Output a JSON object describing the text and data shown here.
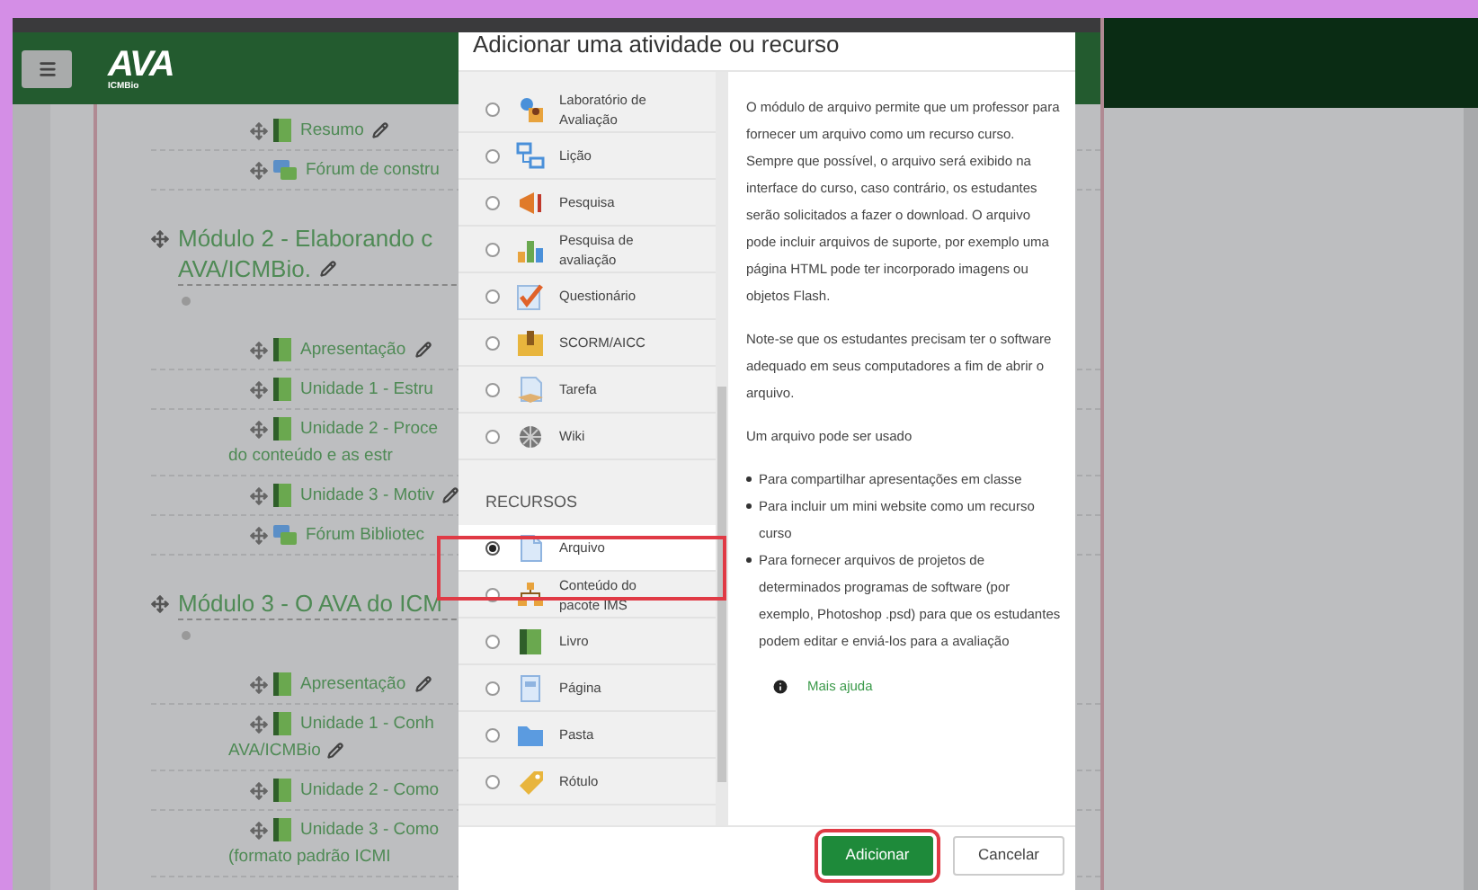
{
  "header": {
    "logo": "AVA",
    "logo_subtitle": "ICMBio"
  },
  "course": {
    "sections": [
      {
        "activities": [
          {
            "kind": "book",
            "lines": [
              "Resumo"
            ],
            "editable": true
          },
          {
            "kind": "forum",
            "lines": [
              "Fórum de constru"
            ],
            "editable": false
          }
        ]
      },
      {
        "title_lines": [
          "Módulo 2 - Elaborando c",
          "AVA/ICMBio."
        ],
        "activities": [
          {
            "kind": "book",
            "lines": [
              "Apresentação"
            ],
            "editable": true
          },
          {
            "kind": "book",
            "lines": [
              "Unidade 1 - Estru"
            ],
            "editable": false
          },
          {
            "kind": "book",
            "lines": [
              "Unidade 2 - Proce",
              "do conteúdo e as estr"
            ],
            "editable": false
          },
          {
            "kind": "book",
            "lines": [
              "Unidade 3 - Motiv"
            ],
            "editable": true
          },
          {
            "kind": "forum",
            "lines": [
              "Fórum Bibliotec"
            ],
            "editable": false
          }
        ]
      },
      {
        "title_lines": [
          "Módulo 3 - O AVA do ICM"
        ],
        "activities": [
          {
            "kind": "book",
            "lines": [
              "Apresentação"
            ],
            "editable": true
          },
          {
            "kind": "book",
            "lines": [
              "Unidade 1 - Conh",
              "AVA/ICMBio"
            ],
            "editable": true
          },
          {
            "kind": "book",
            "lines": [
              "Unidade 2 - Como"
            ],
            "editable": false
          },
          {
            "kind": "book",
            "lines": [
              "Unidade 3 - Como",
              "(formato padrão ICMI"
            ],
            "editable": false
          }
        ]
      }
    ]
  },
  "dialog": {
    "title": "Adicionar uma atividade ou recurso",
    "activities": [
      {
        "label": "Laboratório de Avaliação",
        "kind": "workshop",
        "selected": false
      },
      {
        "label": "Lição",
        "kind": "lesson",
        "selected": false
      },
      {
        "label": "Pesquisa",
        "kind": "survey",
        "selected": false
      },
      {
        "label": "Pesquisa de avaliação",
        "kind": "feedback",
        "selected": false
      },
      {
        "label": "Questionário",
        "kind": "quiz",
        "selected": false
      },
      {
        "label": "SCORM/AICC",
        "kind": "scorm",
        "selected": false
      },
      {
        "label": "Tarefa",
        "kind": "assignment",
        "selected": false
      },
      {
        "label": "Wiki",
        "kind": "wiki",
        "selected": false
      }
    ],
    "resources_heading": "RECURSOS",
    "resources": [
      {
        "label": "Arquivo",
        "kind": "file",
        "selected": true
      },
      {
        "label": "Conteúdo do pacote IMS",
        "kind": "ims",
        "selected": false
      },
      {
        "label": "Livro",
        "kind": "book",
        "selected": false
      },
      {
        "label": "Página",
        "kind": "page",
        "selected": false
      },
      {
        "label": "Pasta",
        "kind": "folder",
        "selected": false
      },
      {
        "label": "Rótulo",
        "kind": "label",
        "selected": false
      }
    ],
    "description": {
      "paragraphs": [
        "O módulo de arquivo permite que um professor para fornecer um arquivo como um recurso curso. Sempre que possível, o arquivo será exibido na interface do curso, caso contrário, os estudantes serão solicitados a fazer o download. O arquivo pode incluir arquivos de suporte, por exemplo uma página HTML pode ter incorporado imagens ou objetos Flash.",
        "Note-se que os estudantes precisam ter o software adequado em seus computadores a fim de abrir o arquivo.",
        "Um arquivo pode ser usado"
      ],
      "bullets": [
        "Para compartilhar apresentações em classe",
        "Para incluir um mini website como um recurso curso",
        "Para fornecer arquivos de projetos de determinados programas de software (por exemplo, Photoshop .psd) para que os estudantes podem editar e enviá-los para a avaliação"
      ],
      "help_link": "Mais ajuda"
    },
    "buttons": [
      {
        "label": "Adicionar",
        "kind": "primary"
      },
      {
        "label": "Cancelar",
        "kind": "secondary"
      }
    ]
  }
}
